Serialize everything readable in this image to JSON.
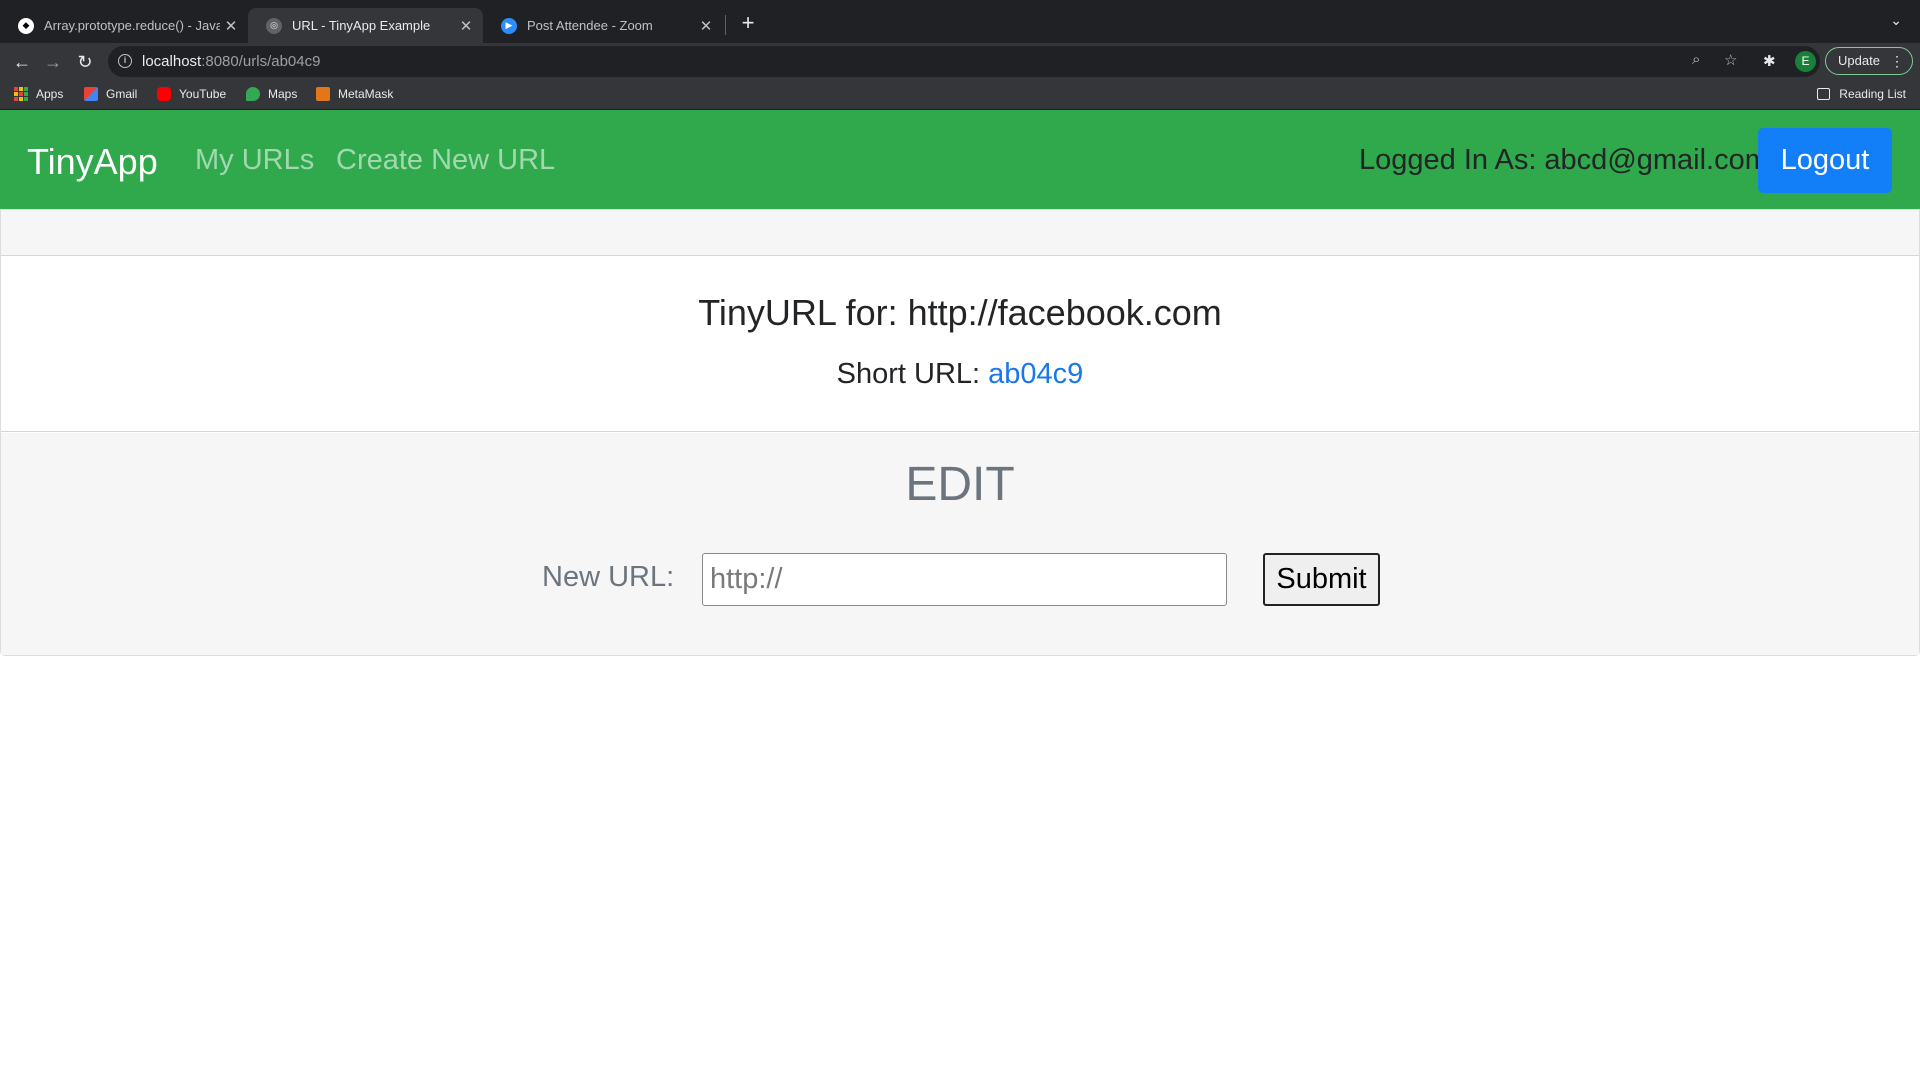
{
  "browser": {
    "tabs": [
      {
        "title": "Array.prototype.reduce() - JavaScript | MDN",
        "active": false
      },
      {
        "title": "URL - TinyApp Example",
        "active": true
      },
      {
        "title": "Post Attendee - Zoom",
        "active": false
      }
    ],
    "address": {
      "host": "localhost",
      "rest": ":8080/urls/ab04c9"
    },
    "profile_initial": "E",
    "update_label": "Update",
    "bookmarks": [
      "Apps",
      "Gmail",
      "YouTube",
      "Maps",
      "MetaMask"
    ],
    "reading_list": "Reading List"
  },
  "navbar": {
    "brand": "TinyApp",
    "links": [
      "My URLs",
      "Create New URL"
    ],
    "logged_in": "Logged In As: abcd@gmail.com",
    "logout": "Logout",
    "color": "#30a84c"
  },
  "card": {
    "title": "TinyURL for: http://facebook.com",
    "short_url_label": "Short URL: ",
    "short_url": "ab04c9",
    "edit_title": "EDIT",
    "form_label": "New URL:",
    "input_placeholder": "http://",
    "submit": "Submit"
  }
}
